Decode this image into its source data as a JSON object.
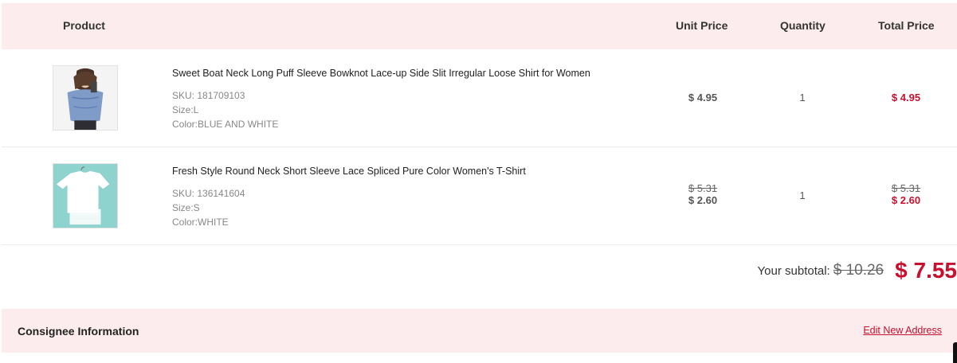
{
  "table_header": {
    "product": "Product",
    "unit_price": "Unit Price",
    "quantity": "Quantity",
    "total_price": "Total Price"
  },
  "items": [
    {
      "title": "Sweet Boat Neck Long Puff Sleeve Bowknot Lace-up Side Slit Irregular Loose Shirt for Women",
      "sku": "SKU: 181709103",
      "size": "Size:L",
      "color": "Color:BLUE AND WHITE",
      "unit_price": "$ 4.95",
      "quantity": "1",
      "total_price": "$ 4.95"
    },
    {
      "title": "Fresh Style Round Neck Short Sleeve Lace Spliced Pure Color Women's T-Shirt",
      "sku": "SKU: 136141604",
      "size": "Size:S",
      "color": "Color:WHITE",
      "unit_price_original": "$ 5.31",
      "unit_price": "$ 2.60",
      "quantity": "1",
      "total_price_original": "$ 5.31",
      "total_price": "$ 2.60"
    }
  ],
  "subtotal": {
    "label": "Your subtotal:",
    "original": "$ 10.26",
    "value": "$ 7.55"
  },
  "consignee": {
    "title": "Consignee Information",
    "edit_link": "Edit New Address"
  },
  "colors": {
    "accent_red": "#c8102e",
    "header_bg": "#fdecee"
  }
}
